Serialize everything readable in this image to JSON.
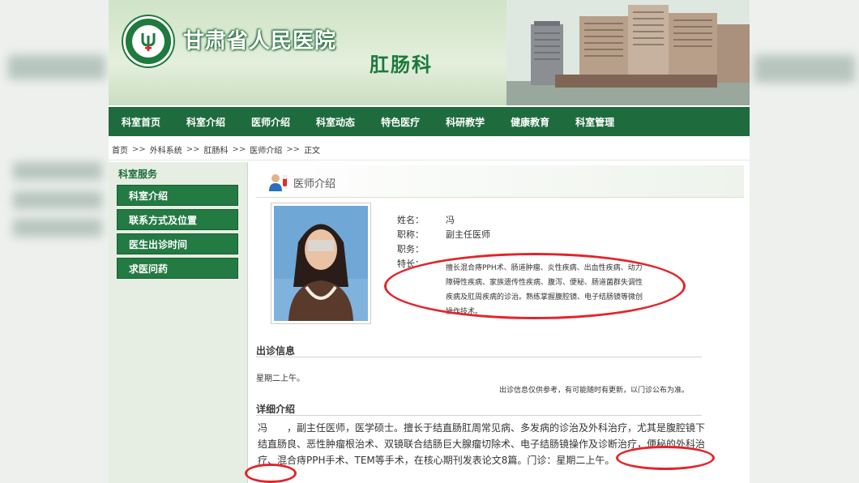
{
  "header": {
    "hospital_name": "甘肃省人民医院",
    "department": "肛肠科"
  },
  "nav": {
    "items": [
      "科室首页",
      "科室介绍",
      "医师介绍",
      "科室动态",
      "特色医疗",
      "科研教学",
      "健康教育",
      "科室管理"
    ]
  },
  "breadcrumb": {
    "items": [
      "首页",
      "外科系统",
      "肛肠科",
      "医师介绍",
      "正文"
    ],
    "separator": ">>"
  },
  "sidebar": {
    "title": "科室服务",
    "items": [
      "科室介绍",
      "联系方式及位置",
      "医生出诊时间",
      "求医问药"
    ]
  },
  "profile": {
    "section_title": "医师介绍",
    "name_label": "姓名：",
    "name_value": "冯",
    "title_label": "职称：",
    "title_value": "副主任医师",
    "position_label": "职务：",
    "position_value": "",
    "specialty_label": "特长：",
    "specialty_value": "擅长混合痔PPH术、肠道肿瘤、炎性疾病、出血性疾病、动力障碍性疾病、家族遗传性疾病、腹泻、便秘、肠道菌群失调性疾病及肛周疾病的诊治。熟练掌握腹腔镜、电子结肠镜等微创操作技术。"
  },
  "visit": {
    "title": "出诊信息",
    "schedule": "星期二上午。",
    "note": "出诊信息仅供参考，有可能随时有更新，以门诊公布为准。"
  },
  "detail": {
    "title": "详细介绍",
    "text": "冯　　，副主任医师，医学硕士。擅长于结直肠肛周常见病、多发病的诊治及外科治疗，尤其是腹腔镜下结直肠良、恶性肿瘤根治术、双镜联合结肠巨大腺瘤切除术、电子结肠镜操作及诊断治疗，便秘的外科治疗、混合痔PPH手术、TEM等手术，在核心期刊发表论文8篇。门诊：星期二上午。"
  },
  "colors": {
    "nav_bg": "#1e6b3e",
    "sidebar_button": "#237a42",
    "highlight_circle": "#e3242b",
    "title_green": "#1c7a3a"
  }
}
